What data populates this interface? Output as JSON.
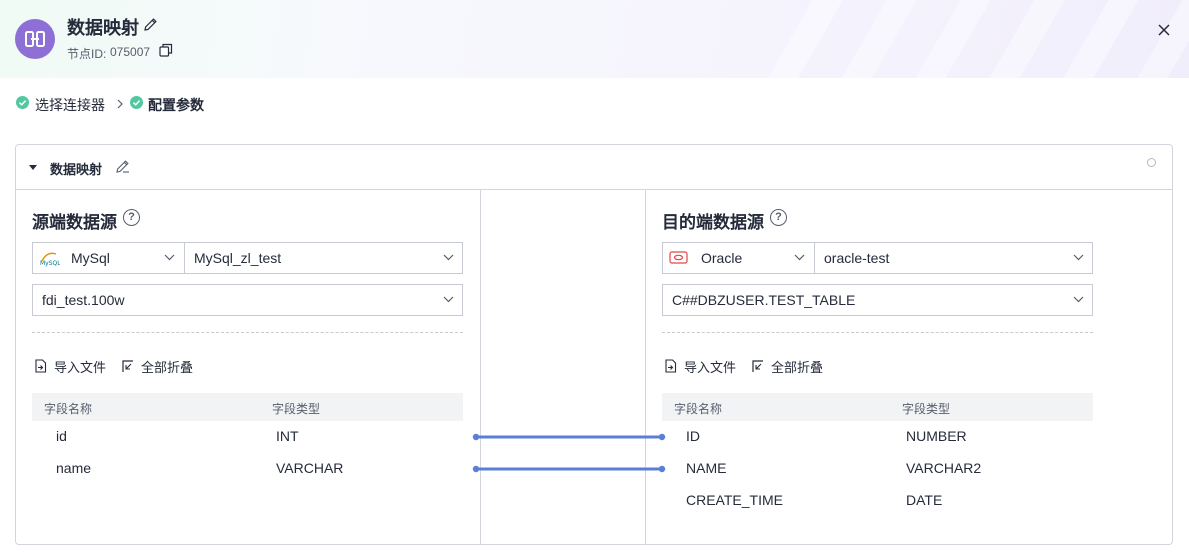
{
  "header": {
    "title": "数据映射",
    "node_id_label": "节点ID:",
    "node_id_value": "075007"
  },
  "steps": [
    {
      "label": "选择连接器",
      "status": "done"
    },
    {
      "label": "配置参数",
      "status": "done",
      "current": true
    }
  ],
  "card": {
    "title": "数据映射"
  },
  "source": {
    "title": "源端数据源",
    "db_type": "MySql",
    "connection": "MySql_zl_test",
    "table": "fdi_test.100w",
    "toolbar": {
      "import": "导入文件",
      "collapse": "全部折叠"
    },
    "columns": [
      "字段名称",
      "字段类型"
    ],
    "rows": [
      {
        "name": "id",
        "type": "INT"
      },
      {
        "name": "name",
        "type": "VARCHAR"
      }
    ]
  },
  "target": {
    "title": "目的端数据源",
    "db_type": "Oracle",
    "connection": "oracle-test",
    "table": "C##DBZUSER.TEST_TABLE",
    "toolbar": {
      "import": "导入文件",
      "collapse": "全部折叠"
    },
    "columns": [
      "字段名称",
      "字段类型"
    ],
    "rows": [
      {
        "name": "ID",
        "type": "NUMBER"
      },
      {
        "name": "NAME",
        "type": "VARCHAR2"
      },
      {
        "name": "CREATE_TIME",
        "type": "DATE"
      }
    ]
  },
  "mappings": [
    {
      "from": "id",
      "to": "ID"
    },
    {
      "from": "name",
      "to": "NAME"
    }
  ],
  "colors": {
    "accent": "#8e6fd6",
    "success": "#50c8a0",
    "link": "#5b7ed6",
    "oracle": "#e0474c"
  }
}
